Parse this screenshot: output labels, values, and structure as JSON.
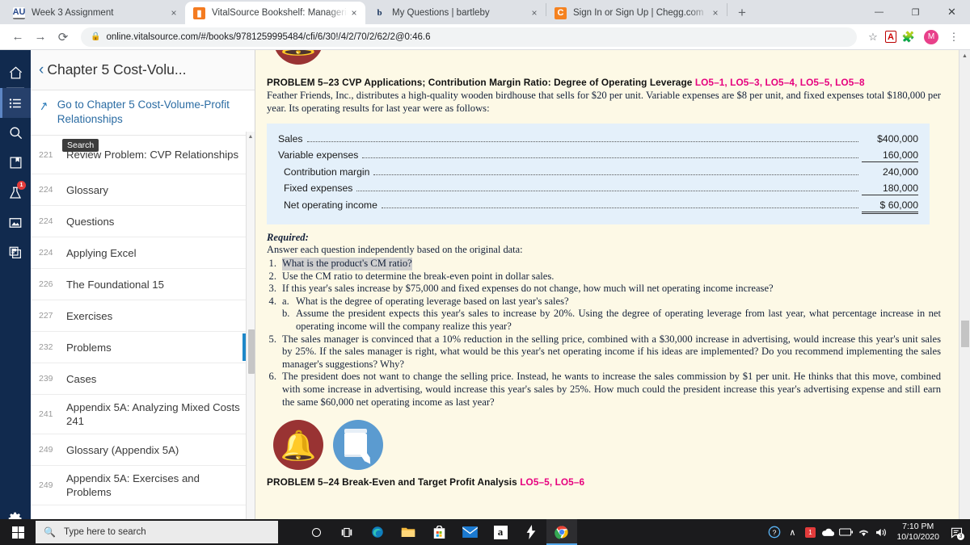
{
  "browser": {
    "tabs": [
      {
        "title": "Week 3 Assignment",
        "favicon": "au-icon",
        "active": false
      },
      {
        "title": "VitalSource Bookshelf: Manageria",
        "favicon": "vitalsource-icon",
        "active": true
      },
      {
        "title": "My Questions | bartleby",
        "favicon": "bartleby-icon",
        "active": false
      },
      {
        "title": "Sign In or Sign Up | Chegg.com",
        "favicon": "chegg-icon",
        "active": false
      }
    ],
    "new_tab_label": "+",
    "close_label": "×",
    "window_controls": {
      "minimize": "—",
      "maximize": "❐",
      "close": "✕"
    },
    "nav": {
      "back": "←",
      "forward": "→",
      "reload": "⟳"
    },
    "url": "online.vitalsource.com/#/books/9781259995484/cfi/6/30!/4/2/70/2/62/2@0:46.6",
    "lock_icon": "lock-icon",
    "toolbar_icons": {
      "bookmark": "☆",
      "pdf": "⤵",
      "extensions": "✦",
      "profile_initial": "M",
      "menu": "⋮"
    }
  },
  "rail": {
    "items": [
      {
        "name": "home-icon",
        "glyph": "⌂",
        "active": false,
        "badge": null
      },
      {
        "name": "table-of-contents-icon",
        "glyph": "≡",
        "active": true,
        "badge": null
      },
      {
        "name": "search-icon",
        "glyph": "⌕",
        "active": false,
        "badge": null
      },
      {
        "name": "bookmark-icon",
        "glyph": "◨",
        "active": false,
        "badge": null
      },
      {
        "name": "flask-icon",
        "glyph": "⚗",
        "active": false,
        "badge": "1"
      },
      {
        "name": "figures-icon",
        "glyph": "▣",
        "active": false,
        "badge": null
      },
      {
        "name": "notes-icon",
        "glyph": "❐",
        "active": false,
        "badge": null
      }
    ],
    "settings": {
      "name": "settings-gear-icon",
      "glyph": "⚙"
    }
  },
  "toc": {
    "back_arrow": "‹",
    "title": "Chapter 5 Cost-Volu...",
    "goto_link": "Go to Chapter 5 Cost-Volume-Profit Relationships",
    "goto_icon": "↗",
    "tooltip": "Search",
    "items": [
      {
        "page": "221",
        "label": "Review Problem: CVP Relationships",
        "current": false
      },
      {
        "page": "224",
        "label": "Glossary",
        "current": false
      },
      {
        "page": "224",
        "label": "Questions",
        "current": false
      },
      {
        "page": "224",
        "label": "Applying Excel",
        "current": false
      },
      {
        "page": "226",
        "label": "The Foundational 15",
        "current": false
      },
      {
        "page": "227",
        "label": "Exercises",
        "current": false
      },
      {
        "page": "232",
        "label": "Problems",
        "current": true
      },
      {
        "page": "239",
        "label": "Cases",
        "current": false
      },
      {
        "page": "241",
        "label": "Appendix 5A: Analyzing Mixed Costs  241",
        "current": false
      },
      {
        "page": "249",
        "label": "Glossary (Appendix 5A)",
        "current": false
      },
      {
        "page": "249",
        "label": "Appendix 5A: Exercises and Problems",
        "current": false
      }
    ]
  },
  "reader": {
    "problem": {
      "heading": "PROBLEM 5–23 CVP Applications; Contribution Margin Ratio: Degree of Operating Leverage",
      "lo_codes": "LO5–1, LO5–3, LO5–4, LO5–5, LO5–8",
      "intro": "Feather Friends, Inc., distributes a high-quality wooden birdhouse that sells for $20 per unit. Variable expenses are $8 per unit, and fixed expenses total $180,000 per year. Its operating results for last year were as follows:"
    },
    "income_statement": {
      "rows": [
        {
          "label": "Sales",
          "value": "$400,000",
          "rule": "none",
          "indent": false
        },
        {
          "label": "Variable expenses",
          "value": "160,000",
          "rule": "single",
          "indent": false
        },
        {
          "label": "Contribution margin",
          "value": "240,000",
          "rule": "none",
          "indent": true
        },
        {
          "label": "Fixed expenses",
          "value": "180,000",
          "rule": "single",
          "indent": true
        },
        {
          "label": "Net operating income",
          "value": "$ 60,000",
          "rule": "double",
          "indent": true
        }
      ]
    },
    "required_title": "Required:",
    "required_sub": "Answer each question independently based on the original data:",
    "questions": [
      {
        "num": "1.",
        "text": "What is the product's CM ratio?",
        "highlighted": true
      },
      {
        "num": "2.",
        "text": "Use the CM ratio to determine the break-even point in dollar sales.",
        "highlighted": false
      },
      {
        "num": "3.",
        "text": "If this year's sales increase by $75,000 and fixed expenses do not change, how much will net operating income increase?",
        "highlighted": false
      },
      {
        "num": "4.",
        "text": "",
        "highlighted": false,
        "sub": [
          {
            "num": "a.",
            "text": "What is the degree of operating leverage based on last year's sales?"
          },
          {
            "num": "b.",
            "text": "Assume the president expects this year's sales to increase by 20%. Using the degree of operating leverage from last year, what percentage increase in net operating income will the company realize this year?"
          }
        ]
      },
      {
        "num": "5.",
        "text": "The sales manager is convinced that a 10% reduction in the selling price, combined with a $30,000 increase in advertising, would increase this year's unit sales by 25%. If the sales manager is right, what would be this year's net operating income if his ideas are implemented? Do you recommend implementing the sales manager's suggestions? Why?",
        "highlighted": false
      },
      {
        "num": "6.",
        "text": "The president does not want to change the selling price. Instead, he wants to increase the sales commission by $1 per unit. He thinks that this move, combined with some increase in advertising, would increase this year's sales by 25%. How much could the president increase this year's advertising expense and still earn the same $60,000 net operating income as last year?",
        "highlighted": false
      }
    ],
    "inline_icons": [
      {
        "name": "bell-notification-icon",
        "color": "#993333"
      },
      {
        "name": "workbook-pencil-icon",
        "color": "#5b9bd0"
      }
    ],
    "next_problem": {
      "heading": "PROBLEM 5–24 Break-Even and Target Profit Analysis",
      "lo_codes": "LO5–5, LO5–6"
    }
  },
  "taskbar": {
    "search_placeholder": "Type here to search",
    "search_icon": "⌕",
    "start_icon": "windows-logo-icon",
    "pinned": [
      {
        "name": "cortana-icon",
        "glyph": "○"
      },
      {
        "name": "task-view-icon",
        "glyph": "⊑"
      },
      {
        "name": "edge-icon",
        "glyph": "◔"
      },
      {
        "name": "file-explorer-icon",
        "glyph": "▬"
      },
      {
        "name": "microsoft-store-icon",
        "glyph": "⊞"
      },
      {
        "name": "mail-icon",
        "glyph": "✉"
      },
      {
        "name": "amazon-icon",
        "glyph": "a"
      },
      {
        "name": "lightning-icon",
        "glyph": "⚡"
      },
      {
        "name": "chrome-icon",
        "glyph": "◎"
      }
    ],
    "tray": {
      "help_icon": "?",
      "chevron": "∧",
      "updates_badge": "1",
      "onedrive_icon": "☁",
      "battery_icon": "▭",
      "wifi_icon": "◠",
      "volume_icon": "🔊",
      "time": "7:10 PM",
      "date": "10/10/2020",
      "notification_count": "3"
    }
  }
}
